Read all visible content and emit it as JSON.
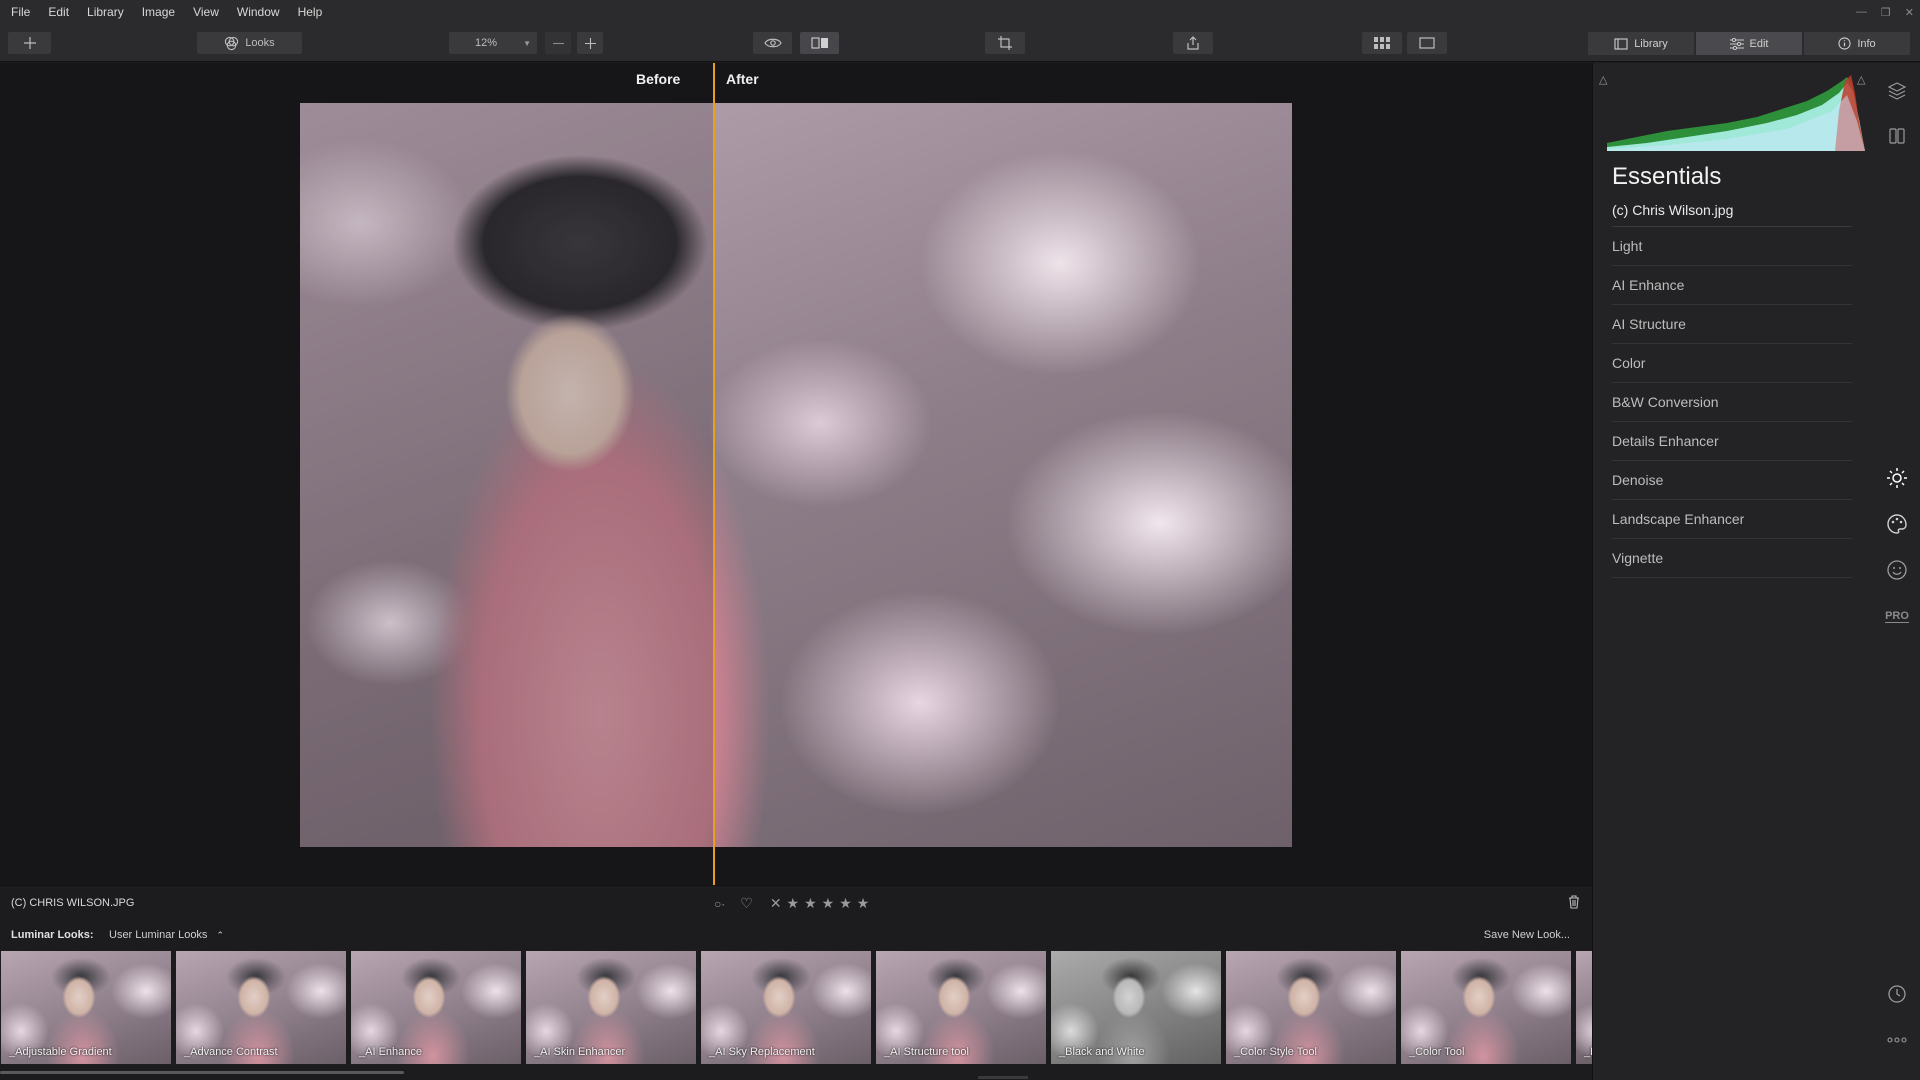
{
  "menu": [
    "File",
    "Edit",
    "Library",
    "Image",
    "View",
    "Window",
    "Help"
  ],
  "toolbar": {
    "looks_label": "Looks",
    "zoom_value": "12%"
  },
  "tabs": [
    {
      "label": "Library",
      "icon": "library-icon"
    },
    {
      "label": "Edit",
      "icon": "sliders-icon"
    },
    {
      "label": "Info",
      "icon": "info-icon"
    }
  ],
  "compare": {
    "before_label": "Before",
    "after_label": "After",
    "split_color": "#e8a020"
  },
  "info_bar": {
    "file_name": "(C) CHRIS WILSON.JPG",
    "stars": [
      "★",
      "★",
      "★",
      "★",
      "★"
    ]
  },
  "looks_bar": {
    "label": "Luminar Looks:",
    "dropdown": "User Luminar Looks",
    "save_button": "Save New Look..."
  },
  "looks": [
    {
      "name": "_Adjustable Gradient",
      "bw": false
    },
    {
      "name": "_Advance Contrast",
      "bw": false
    },
    {
      "name": "_AI Enhance",
      "bw": false
    },
    {
      "name": "_AI Skin Enhancer",
      "bw": false
    },
    {
      "name": "_AI Sky Replacement",
      "bw": false
    },
    {
      "name": "_AI Structure tool",
      "bw": false
    },
    {
      "name": "_Black and White",
      "bw": true
    },
    {
      "name": "_Color Style Tool",
      "bw": false
    },
    {
      "name": "_Color Tool",
      "bw": false
    },
    {
      "name": "_D",
      "bw": false
    }
  ],
  "panel": {
    "title": "Essentials",
    "file": "(c) Chris Wilson.jpg",
    "tools": [
      "Light",
      "AI Enhance",
      "AI Structure",
      "Color",
      "B&W Conversion",
      "Details Enhancer",
      "Denoise",
      "Landscape Enhancer",
      "Vignette"
    ],
    "pro_label": "PRO"
  },
  "colors": {
    "accent": "#e8a020",
    "panel_bg": "#232325",
    "canvas_bg": "#161618"
  }
}
